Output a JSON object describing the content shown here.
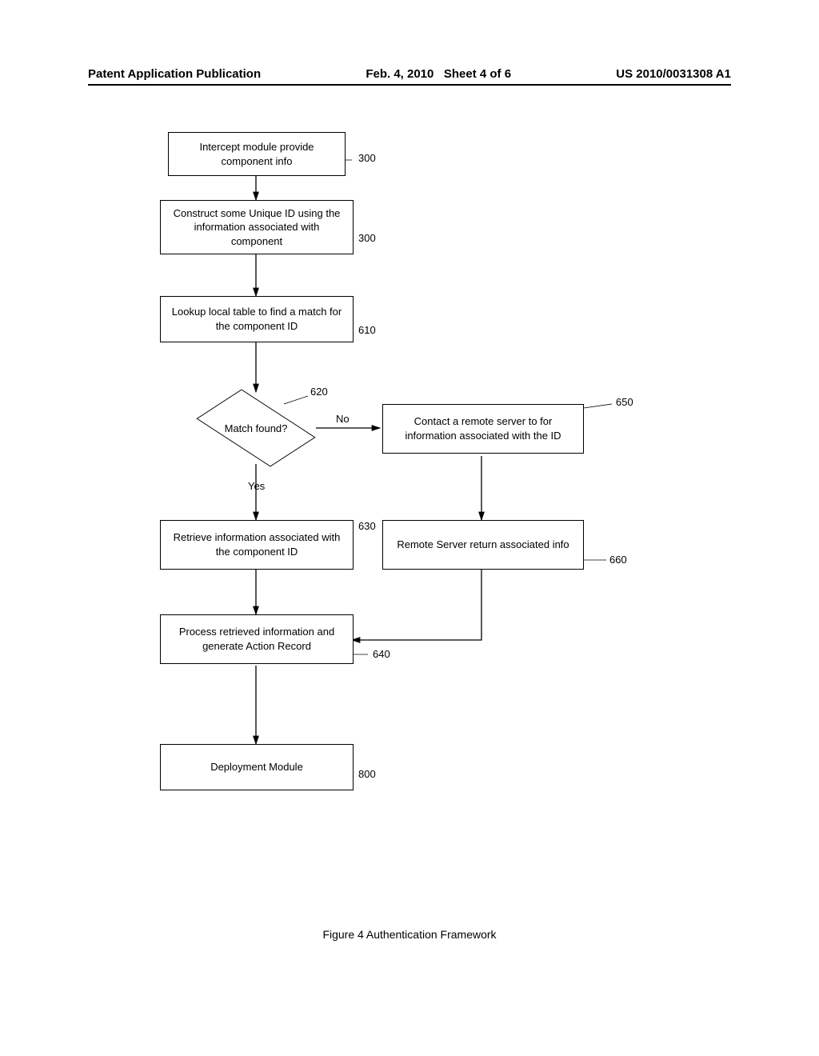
{
  "header": {
    "left": "Patent Application Publication",
    "center": "Feb. 4, 2010   Sheet 4 of 6",
    "right": "US 2010/0031308 A1"
  },
  "flow": {
    "b1": {
      "text": "Intercept module provide component info",
      "ref": "300"
    },
    "b2": {
      "text": "Construct some Unique ID using the information associated with component",
      "ref": "300"
    },
    "b3": {
      "text": "Lookup local table to find a match for the component ID",
      "ref": "610"
    },
    "d1": {
      "text": "Match found?",
      "ref": "620",
      "yes": "Yes",
      "no": "No"
    },
    "b5": {
      "text": "Retrieve information associated with the component ID",
      "ref": "630"
    },
    "b6": {
      "text": "Contact a remote server to for information associated with the ID",
      "ref": "650"
    },
    "b7": {
      "text": "Remote Server return associated info",
      "ref": "660"
    },
    "b8": {
      "text": "Process retrieved information and generate Action Record",
      "ref": "640"
    },
    "b9": {
      "text": "Deployment Module",
      "ref": "800"
    }
  },
  "caption": "Figure 4 Authentication Framework"
}
